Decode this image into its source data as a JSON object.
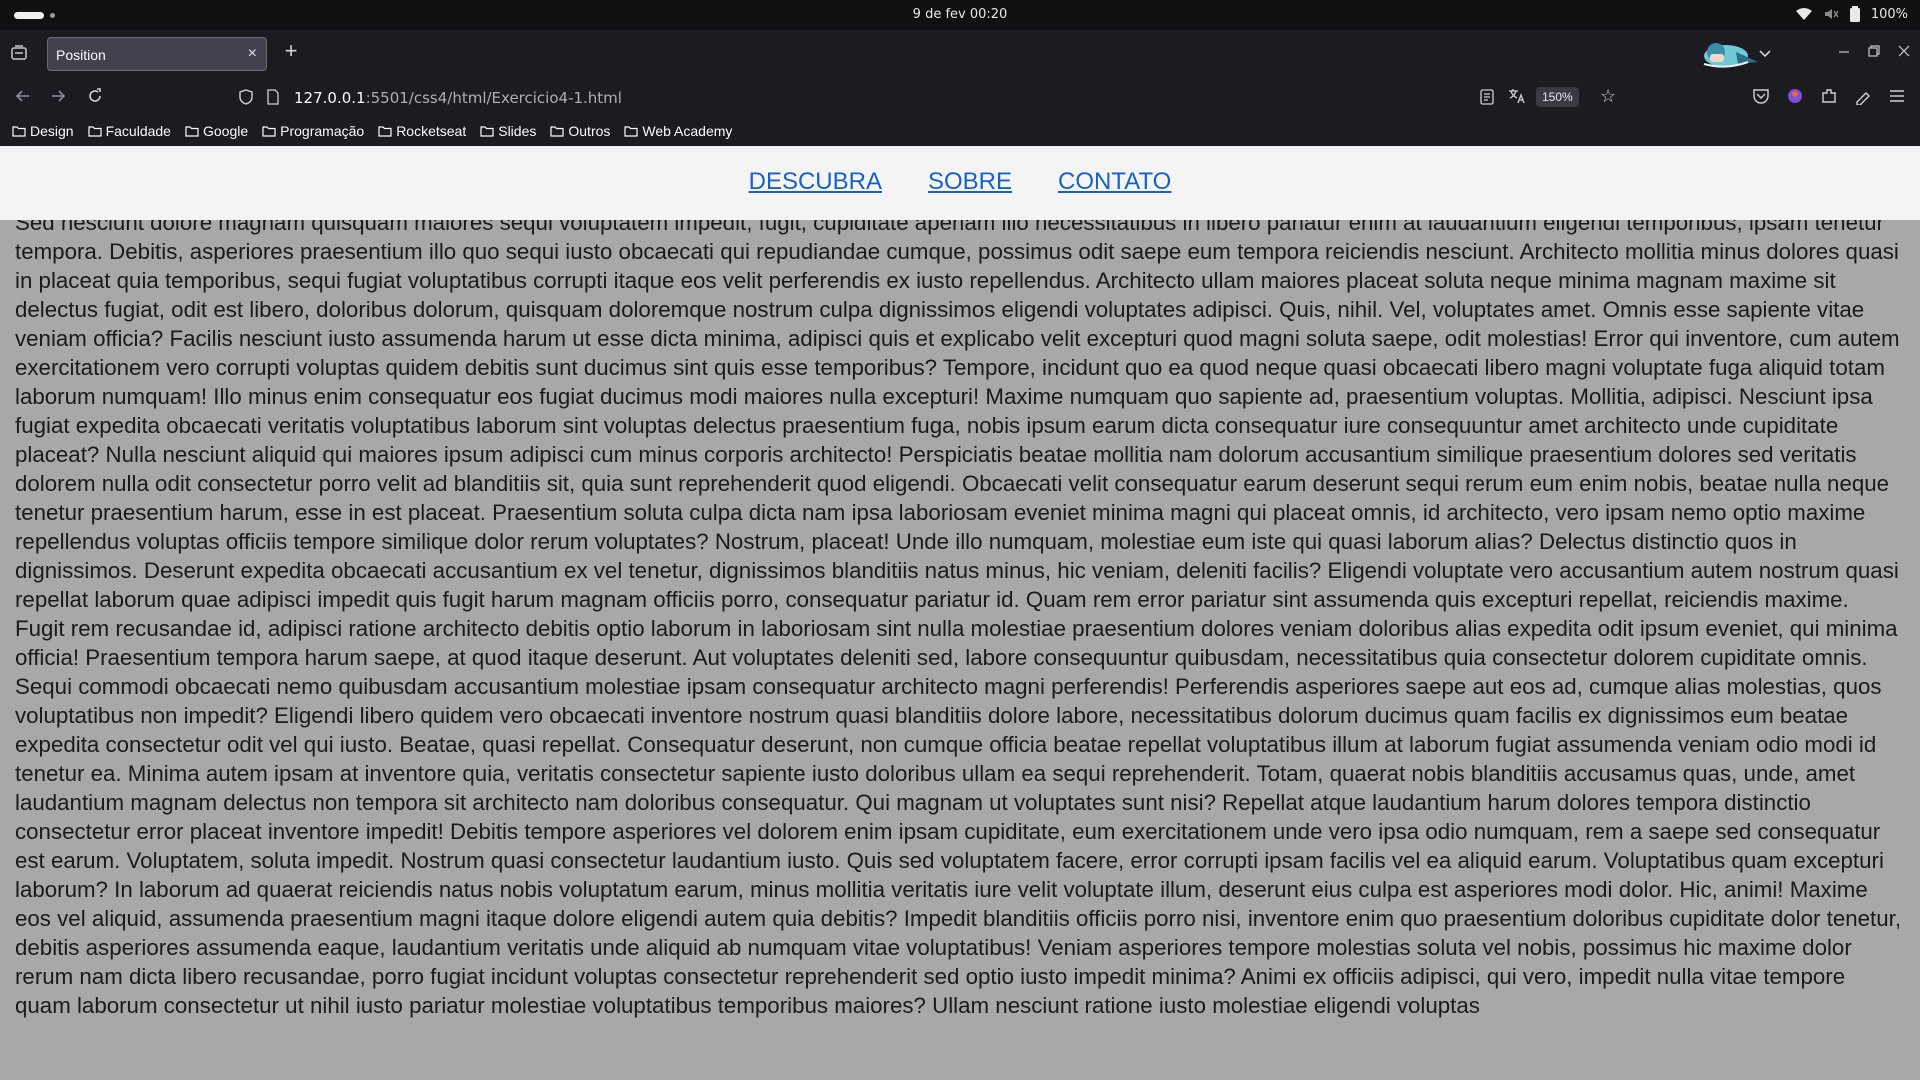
{
  "os": {
    "clock": "9 de fev  00:20",
    "battery": "100%"
  },
  "browser": {
    "tab_title": "Position",
    "url_host": "127.0.0.1",
    "url_rest": ":5501/css4/html/Exercicio4-1.html",
    "zoom": "150%",
    "bookmarks": [
      "Design",
      "Faculdade",
      "Google",
      "Programação",
      "Rocketseat",
      "Slides",
      "Outros",
      "Web Academy"
    ]
  },
  "site": {
    "nav": [
      "DESCUBRA",
      "SOBRE",
      "CONTATO"
    ],
    "body_text": "Sed nesciunt dolore magnam quisquam maiores sequi voluptatem impedit, fugit, cupiditate aperiam illo necessitatibus in libero pariatur enim at laudantium eligendi temporibus, ipsam tenetur tempora. Debitis, asperiores praesentium illo quo sequi iusto obcaecati qui repudiandae cumque, possimus odit saepe eum tempora reiciendis nesciunt. Architecto mollitia minus dolores quasi in placeat quia temporibus, sequi fugiat voluptatibus corrupti itaque eos velit perferendis ex iusto repellendus. Architecto ullam maiores placeat soluta neque minima magnam maxime sit delectus fugiat, odit est libero, doloribus dolorum, quisquam doloremque nostrum culpa dignissimos eligendi voluptates adipisci. Quis, nihil. Vel, voluptates amet. Omnis esse sapiente vitae veniam officia? Facilis nesciunt iusto assumenda harum ut esse dicta minima, adipisci quis et explicabo velit excepturi quod magni soluta saepe, odit molestias! Error qui inventore, cum autem exercitationem vero corrupti voluptas quidem debitis sunt ducimus sint quis esse temporibus? Tempore, incidunt quo ea quod neque quasi obcaecati libero magni voluptate fuga aliquid totam laborum numquam! Illo minus enim consequatur eos fugiat ducimus modi maiores nulla excepturi! Maxime numquam quo sapiente ad, praesentium voluptas. Mollitia, adipisci. Nesciunt ipsa fugiat expedita obcaecati veritatis voluptatibus laborum sint voluptas delectus praesentium fuga, nobis ipsum earum dicta consequatur iure consequuntur amet architecto unde cupiditate placeat? Nulla nesciunt aliquid qui maiores ipsum adipisci cum minus corporis architecto! Perspiciatis beatae mollitia nam dolorum accusantium similique praesentium dolores sed veritatis dolorem nulla odit consectetur porro velit ad blanditiis sit, quia sunt reprehenderit quod eligendi. Obcaecati velit consequatur earum deserunt sequi rerum eum enim nobis, beatae nulla neque tenetur praesentium harum, esse in est placeat. Praesentium soluta culpa dicta nam ipsa laboriosam eveniet minima magni qui placeat omnis, id architecto, vero ipsam nemo optio maxime repellendus voluptas officiis tempore similique dolor rerum voluptates? Nostrum, placeat! Unde illo numquam, molestiae eum iste qui quasi laborum alias? Delectus distinctio quos in dignissimos. Deserunt expedita obcaecati accusantium ex vel tenetur, dignissimos blanditiis natus minus, hic veniam, deleniti facilis? Eligendi voluptate vero accusantium autem nostrum quasi repellat laborum quae adipisci impedit quis fugit harum magnam officiis porro, consequatur pariatur id. Quam rem error pariatur sint assumenda quis excepturi repellat, reiciendis maxime. Fugit rem recusandae id, adipisci ratione architecto debitis optio laborum in laboriosam sint nulla molestiae praesentium dolores veniam doloribus alias expedita odit ipsum eveniet, qui minima officia! Praesentium tempora harum saepe, at quod itaque deserunt. Aut voluptates deleniti sed, labore consequuntur quibusdam, necessitatibus quia consectetur dolorem cupiditate omnis. Sequi commodi obcaecati nemo quibusdam accusantium molestiae ipsam consequatur architecto magni perferendis! Perferendis asperiores saepe aut eos ad, cumque alias molestias, quos voluptatibus non impedit? Eligendi libero quidem vero obcaecati inventore nostrum quasi blanditiis dolore labore, necessitatibus dolorum ducimus quam facilis ex dignissimos eum beatae expedita consectetur odit vel qui iusto. Beatae, quasi repellat. Consequatur deserunt, non cumque officia beatae repellat voluptatibus illum at laborum fugiat assumenda veniam odio modi id tenetur ea. Minima autem ipsam at inventore quia, veritatis consectetur sapiente iusto doloribus ullam ea sequi reprehenderit. Totam, quaerat nobis blanditiis accusamus quas, unde, amet laudantium magnam delectus non tempora sit architecto nam doloribus consequatur. Qui magnam ut voluptates sunt nisi? Repellat atque laudantium harum dolores tempora distinctio consectetur error placeat inventore impedit! Debitis tempore asperiores vel dolorem enim ipsam cupiditate, eum exercitationem unde vero ipsa odio numquam, rem a saepe sed consequatur est earum. Voluptatem, soluta impedit. Nostrum quasi consectetur laudantium iusto. Quis sed voluptatem facere, error corrupti ipsam facilis vel ea aliquid earum. Voluptatibus quam excepturi laborum? In laborum ad quaerat reiciendis natus nobis voluptatum earum, minus mollitia veritatis iure velit voluptate illum, deserunt eius culpa est asperiores modi dolor. Hic, animi! Maxime eos vel aliquid, assumenda praesentium magni itaque dolore eligendi autem quia debitis? Impedit blanditiis officiis porro nisi, inventore enim quo praesentium doloribus cupiditate dolor tenetur, debitis asperiores assumenda eaque, laudantium veritatis unde aliquid ab numquam vitae voluptatibus! Veniam asperiores tempore molestias soluta vel nobis, possimus hic maxime dolor rerum nam dicta libero recusandae, porro fugiat incidunt voluptas consectetur reprehenderit sed optio iusto impedit minima? Animi ex officiis adipisci, qui vero, impedit nulla vitae tempore quam laborum consectetur ut nihil iusto pariatur molestiae voluptatibus temporibus maiores? Ullam nesciunt ratione iusto molestiae eligendi voluptas"
  }
}
